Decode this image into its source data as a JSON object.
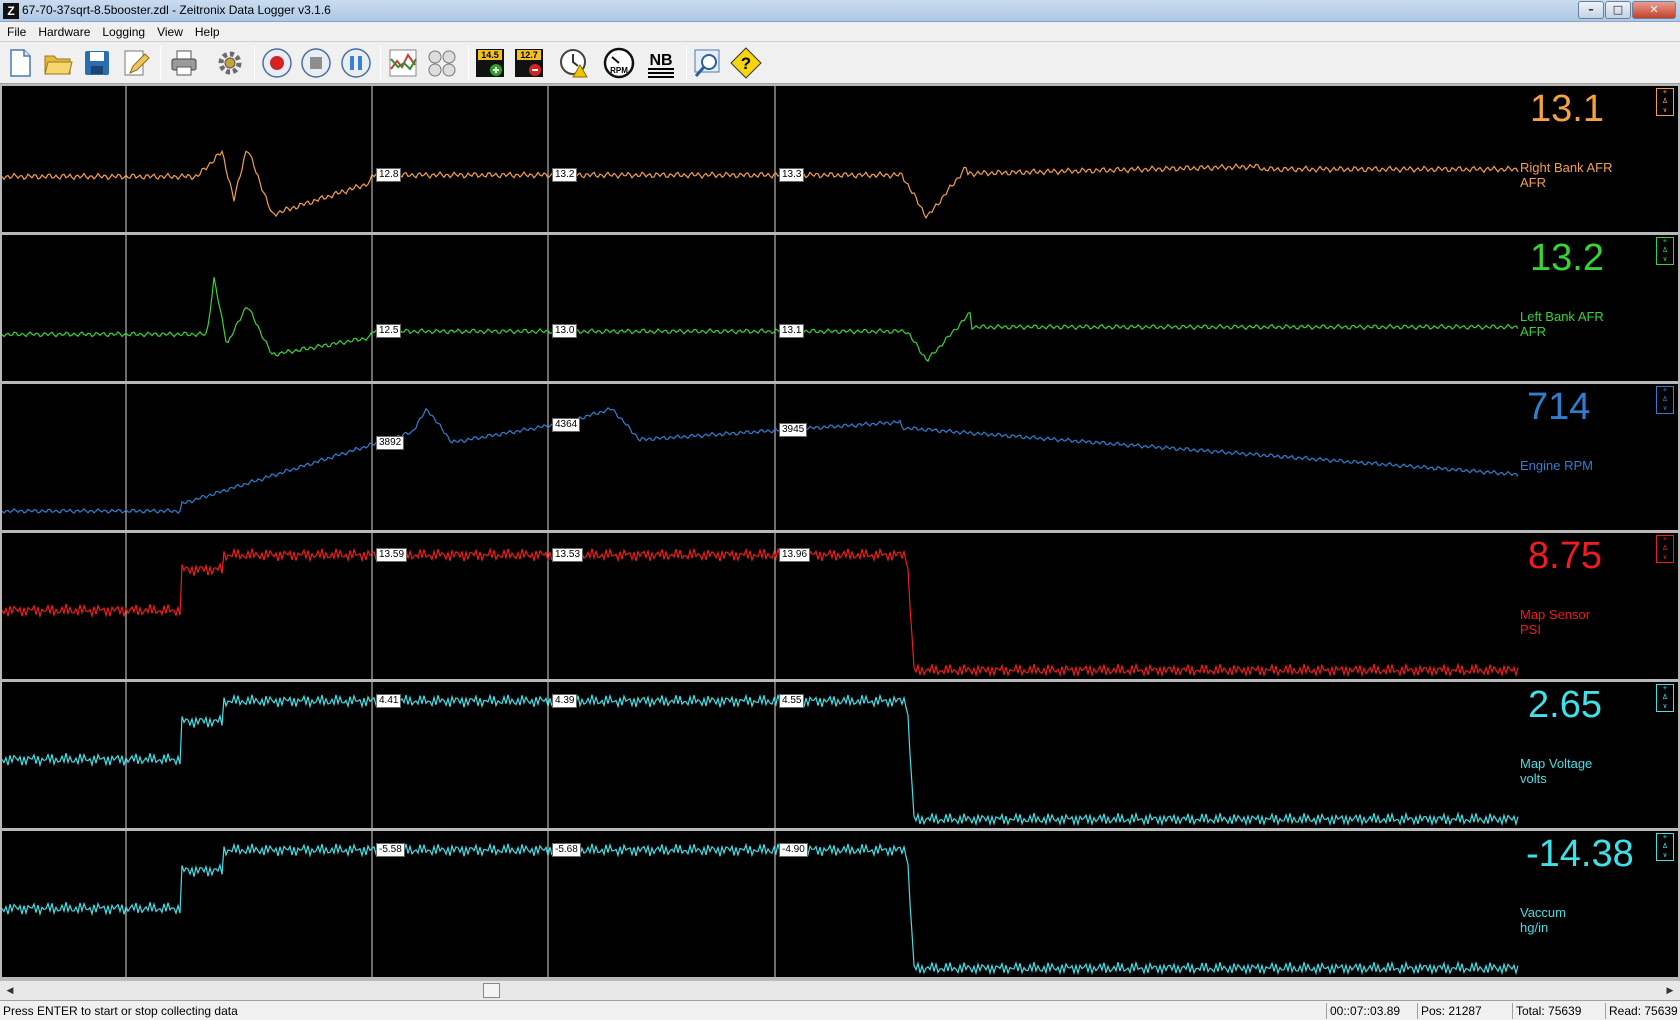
{
  "window": {
    "title": "67-70-37sqrt-8.5booster.zdl - Zeitronix Data Logger v3.1.6",
    "app_icon": "Z",
    "minimize": "–",
    "maximize": "□",
    "close": "✕"
  },
  "menu": [
    "File",
    "Hardware",
    "Logging",
    "View",
    "Help"
  ],
  "toolbar": {
    "icons": [
      "new-file-icon",
      "open-folder-icon",
      "save-disk-icon",
      "edit-pencil-icon",
      "print-icon",
      "settings-gear-icon",
      "record-icon",
      "stop-icon",
      "pause-icon",
      "graph-icon",
      "gauges-icon",
      "afr-target-plus-icon",
      "afr-target-minus-icon",
      "timer-warning-icon",
      "rpm-gauge-icon",
      "nb-icon",
      "zoom-chart-icon",
      "help-icon"
    ],
    "afr_plus_value": "14.5",
    "afr_minus_value": "12.7",
    "rpm_text": "RPM",
    "nb_text": "NB",
    "help_text": "?"
  },
  "channels": [
    {
      "id": "right-bank-afr",
      "value": "13.1",
      "name": "Right Bank AFR",
      "unit": "AFR",
      "color": "#f5a042",
      "cursor_values": [
        "12.8",
        "13.2",
        "13.3"
      ]
    },
    {
      "id": "left-bank-afr",
      "value": "13.2",
      "name": "Left Bank AFR",
      "unit": "AFR",
      "color": "#34d634",
      "cursor_values": [
        "12.5",
        "13.0",
        "13.1"
      ]
    },
    {
      "id": "engine-rpm",
      "value": "714",
      "name": "Engine RPM",
      "unit": "",
      "color": "#2f7fd1",
      "cursor_values": [
        "3892",
        "4364",
        "3945"
      ]
    },
    {
      "id": "map-sensor",
      "value": "8.75",
      "name": "Map Sensor",
      "unit": "PSI",
      "color": "#ee1c1c",
      "cursor_values": [
        "13.59",
        "13.53",
        "13.96"
      ]
    },
    {
      "id": "map-voltage",
      "value": "2.65",
      "name": "Map Voltage",
      "unit": "volts",
      "color": "#3fe0e8",
      "cursor_values": [
        "4.41",
        "4.39",
        "4.55"
      ]
    },
    {
      "id": "vaccum",
      "value": "-14.38",
      "name": "Vaccum",
      "unit": "hg/in",
      "color": "#3fe0e8",
      "cursor_values": [
        "-5.58",
        "-5.68",
        "-4.90"
      ]
    }
  ],
  "panel_controls": [
    "+",
    "Δ",
    "∨",
    "○"
  ],
  "scrollbar": {
    "left_arrow": "◀",
    "right_arrow": "▶"
  },
  "status": {
    "message": "Press ENTER to start or stop collecting data",
    "time": "00::07::03.89",
    "pos": "Pos: 21287",
    "total": "Total: 75639",
    "read": "Read: 75639"
  }
}
